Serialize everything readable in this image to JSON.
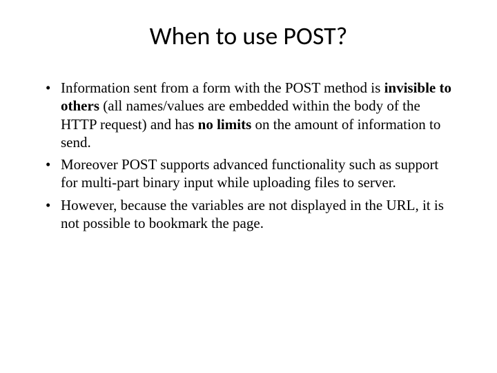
{
  "slide": {
    "title": "When to use POST?",
    "bullets": [
      {
        "pre": "Information sent from a form with the POST method is ",
        "b1": "invisible to others",
        "mid": " (all names/values are embedded within the body of the HTTP request) and has ",
        "b2": "no limits",
        "post": " on the amount of information to send."
      },
      {
        "text": "Moreover POST supports advanced functionality such as support for multi-part binary input while uploading files to server."
      },
      {
        "text": "However, because the variables are not displayed in the URL, it is not possible to bookmark the page."
      }
    ]
  }
}
